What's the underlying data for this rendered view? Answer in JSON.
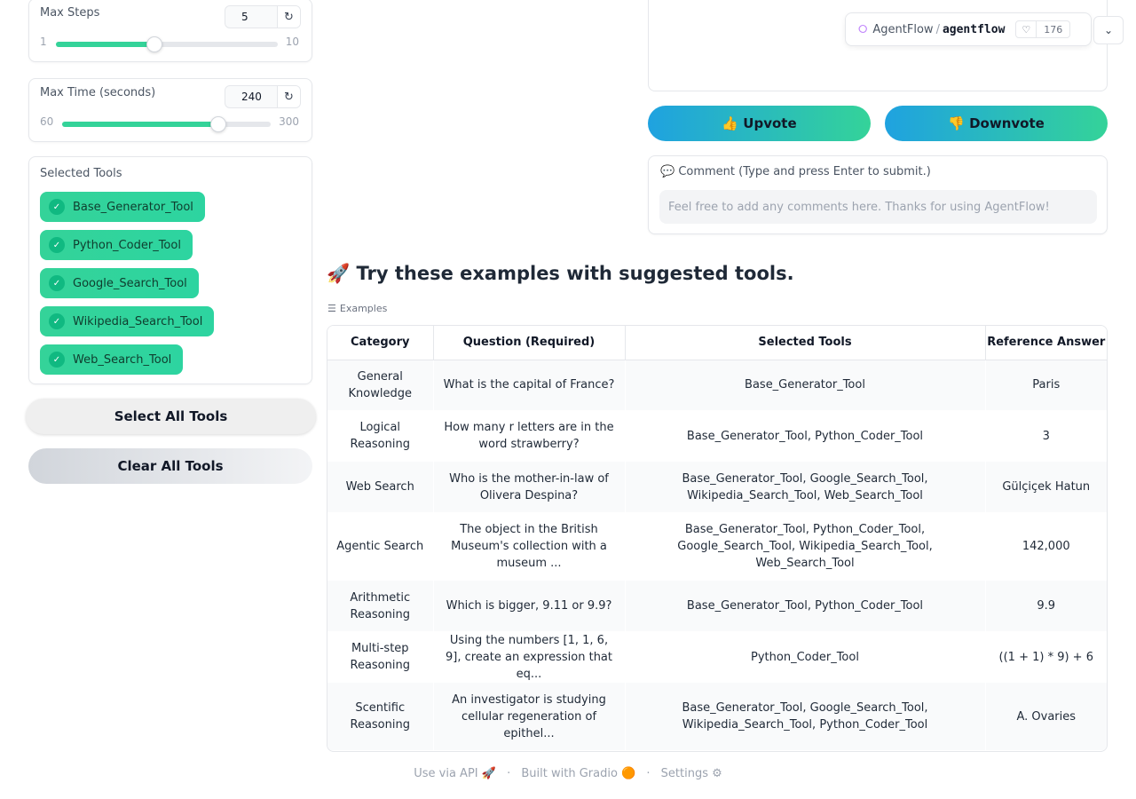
{
  "sliders": {
    "max_steps": {
      "label": "Max Steps",
      "value": "5",
      "min": "1",
      "max": "10",
      "fraction": 0.444
    },
    "max_time": {
      "label": "Max Time (seconds)",
      "value": "240",
      "min": "60",
      "max": "300",
      "fraction": 0.75
    }
  },
  "reset_icon": "↻",
  "tools": {
    "title": "Selected Tools",
    "items": [
      {
        "label": "Base_Generator_Tool",
        "checked": true
      },
      {
        "label": "Python_Coder_Tool",
        "checked": true
      },
      {
        "label": "Google_Search_Tool",
        "checked": true
      },
      {
        "label": "Wikipedia_Search_Tool",
        "checked": true
      },
      {
        "label": "Web_Search_Tool",
        "checked": true
      }
    ],
    "select_all": "Select All Tools",
    "clear_all": "Clear All Tools"
  },
  "hf_badge": {
    "org": "AgentFlow",
    "repo": "agentflow",
    "likes": "176",
    "icon": "space-icon"
  },
  "vote": {
    "upvote": "👍 Upvote",
    "downvote": "👎 Downvote"
  },
  "comment": {
    "label": "💬 Comment (Type and press Enter to submit.)",
    "placeholder": "Feel free to add any comments here. Thanks for using AgentFlow!"
  },
  "examples": {
    "heading": "🚀 Try these examples with suggested tools.",
    "label": "Examples",
    "columns": [
      "Category",
      "Question (Required)",
      "Selected Tools",
      "Reference Answer"
    ],
    "rows": [
      [
        "General Knowledge",
        "What is the capital of France?",
        "Base_Generator_Tool",
        "Paris"
      ],
      [
        "Logical Reasoning",
        "How many r letters are in the word strawberry?",
        "Base_Generator_Tool, Python_Coder_Tool",
        "3"
      ],
      [
        "Web Search",
        "Who is the mother-in-law of Olivera Despina?",
        "Base_Generator_Tool, Google_Search_Tool, Wikipedia_Search_Tool, Web_Search_Tool",
        "Gülçiçek Hatun"
      ],
      [
        "Agentic Search",
        "The object in the British Museum's collection with a museum ...",
        "Base_Generator_Tool, Python_Coder_Tool, Google_Search_Tool, Wikipedia_Search_Tool, Web_Search_Tool",
        "142,000"
      ],
      [
        "Arithmetic Reasoning",
        "Which is bigger, 9.11 or 9.9?",
        "Base_Generator_Tool, Python_Coder_Tool",
        "9.9"
      ],
      [
        "Multi-step Reasoning",
        "Using the numbers [1, 1, 6, 9], create an expression that eq...",
        "Python_Coder_Tool",
        "((1 + 1) * 9) + 6"
      ],
      [
        "Scentific Reasoning",
        "An investigator is studying cellular regeneration of epithel...",
        "Base_Generator_Tool, Google_Search_Tool, Wikipedia_Search_Tool, Python_Coder_Tool",
        "A. Ovaries"
      ]
    ]
  },
  "footer": {
    "api": "Use via API 🚀",
    "gradio": "Built with Gradio 🟠",
    "settings": "Settings ⚙",
    "sep": "·"
  }
}
